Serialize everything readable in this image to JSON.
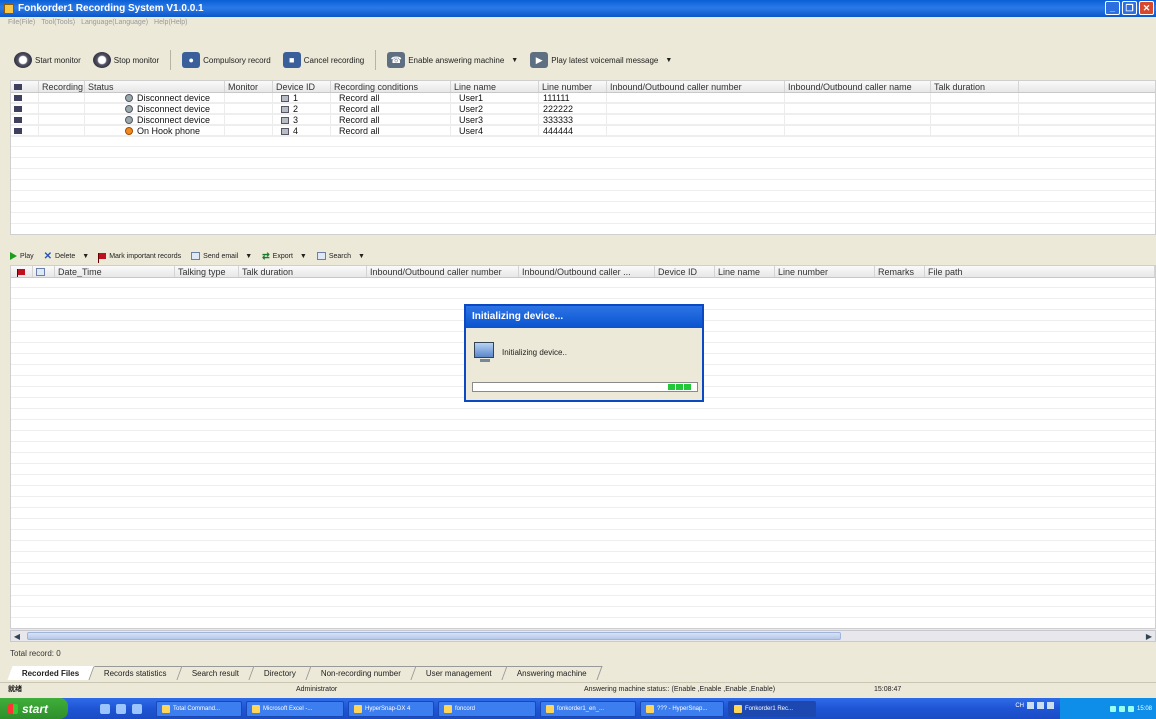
{
  "window": {
    "title": "Fonkorder1 Recording System V1.0.0.1",
    "controls": [
      "_",
      "̅",
      "X"
    ]
  },
  "menu": [
    "File(File)",
    "Tool(Tools)",
    "Language(Language)",
    "Help(Help)"
  ],
  "toolbar": {
    "start_monitor": "Start monitor",
    "stop_monitor": "Stop monitor",
    "compulsory_record": "Compulsory record",
    "cancel_recording": "Cancel recording",
    "enable_answering": "Enable answering machine",
    "play_voicemail": "Play latest voicemail message"
  },
  "devices": {
    "columns": [
      "",
      "Recording",
      "Status",
      "Monitor",
      "Device ID",
      "Recording conditions",
      "Line name",
      "Line number",
      "Inbound/Outbound caller number",
      "Inbound/Outbound caller name",
      "Talk duration"
    ],
    "rows": [
      {
        "status": "Disconnect device",
        "status_icon": "disconnected-icon",
        "device_id": "1",
        "conditions": "Record all",
        "line_name": "User1",
        "line_number": "111111"
      },
      {
        "status": "Disconnect device",
        "status_icon": "disconnected-icon",
        "device_id": "2",
        "conditions": "Record all",
        "line_name": "User2",
        "line_number": "222222"
      },
      {
        "status": "Disconnect device",
        "status_icon": "disconnected-icon",
        "device_id": "3",
        "conditions": "Record all",
        "line_name": "User3",
        "line_number": "333333"
      },
      {
        "status": "On Hook phone",
        "status_icon": "on-hook-icon",
        "device_id": "4",
        "conditions": "Record all",
        "line_name": "User4",
        "line_number": "444444"
      }
    ]
  },
  "records_toolbar": {
    "play": "Play",
    "delete": "Delete",
    "mark_important": "Mark important records",
    "send_email": "Send email",
    "export": "Export",
    "search": "Search"
  },
  "records": {
    "columns": [
      "",
      "",
      "Date_Time",
      "Talking type",
      "Talk duration",
      "Inbound/Outbound caller number",
      "Inbound/Outbound caller ...",
      "Device ID",
      "Line name",
      "Line number",
      "Remarks",
      "File path"
    ]
  },
  "dialog": {
    "title": "Initializing device...",
    "message": "Initializing device..",
    "progress_blocks": 3
  },
  "total_record": "Total record: 0",
  "tabs": [
    "Recorded Files",
    "Records statistics",
    "Search result",
    "Directory",
    "Non-recording number",
    "User management",
    "Answering machine"
  ],
  "statusbar": {
    "left": "就绪",
    "user": "Administrator",
    "answering_status": "Answering machine status:: (Enable ,Enable ,Enable ,Enable)",
    "time": "15:08:47"
  },
  "taskbar": {
    "start": "start",
    "tasks": [
      "Total Command...",
      "Microsoft Excel -...",
      "HyperSnap-DX 4",
      "foncord",
      "fonkorder1_en_...",
      "??? - HyperSnap...",
      "Fonkorder1 Rec..."
    ],
    "ime": "CH",
    "clock": "15:08"
  }
}
